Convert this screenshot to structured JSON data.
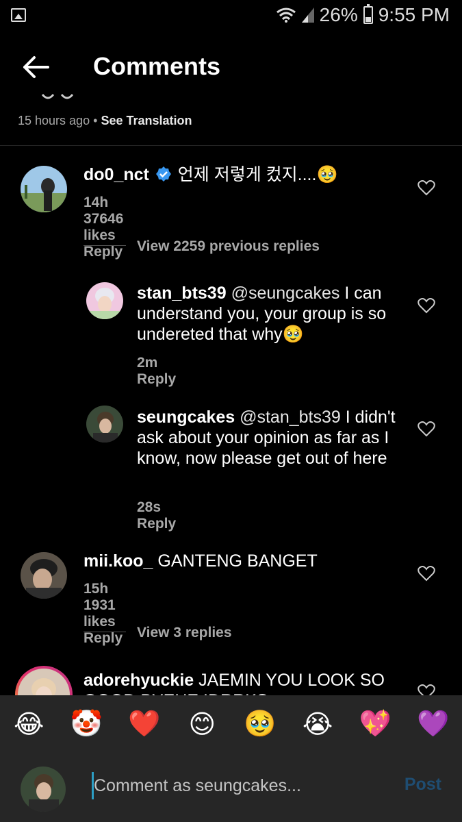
{
  "status_bar": {
    "battery": "26%",
    "time": "9:55 PM"
  },
  "header": {
    "title": "Comments"
  },
  "caption": {
    "time_ago": "15 hours ago",
    "separator": "•",
    "see_translation": "See Translation"
  },
  "comments": [
    {
      "username": "do0_nct",
      "verified": true,
      "text": "언제 저렇게 컸지....🥹",
      "time": "14h",
      "likes": "37646 likes",
      "reply": "Reply",
      "view_replies": "View 2259 previous replies",
      "replies": [
        {
          "username": "stan_bts39",
          "mention": "@seungcakes",
          "text": " I can understand you, your group is so undereted that why🥹",
          "time": "2m",
          "reply": "Reply"
        },
        {
          "username": "seungcakes",
          "mention": "@stan_bts39",
          "text": " I didn't ask about your opinion as far as I know, now please get out of here",
          "time": "28s",
          "reply": "Reply"
        }
      ]
    },
    {
      "username": "mii.koo_",
      "text": "GANTENG BANGET",
      "time": "15h",
      "likes": "1931 likes",
      "reply": "Reply",
      "view_replies": "View 3 replies"
    },
    {
      "username": "adorehyuckie",
      "text": "JAEMIN YOU LOOK SO GOOD BYEHE IDRRKS"
    }
  ],
  "emoji_bar": [
    "😂",
    "🤡",
    "❤️",
    "😊",
    "🥹",
    "😭",
    "💖",
    "💜"
  ],
  "comment_input": {
    "placeholder": "Comment as seungcakes...",
    "post_label": "Post"
  },
  "colors": {
    "background": "#000000",
    "secondary_text": "#a8a8a8",
    "post_disabled": "#1f4d72",
    "verified": "#3897f0"
  }
}
